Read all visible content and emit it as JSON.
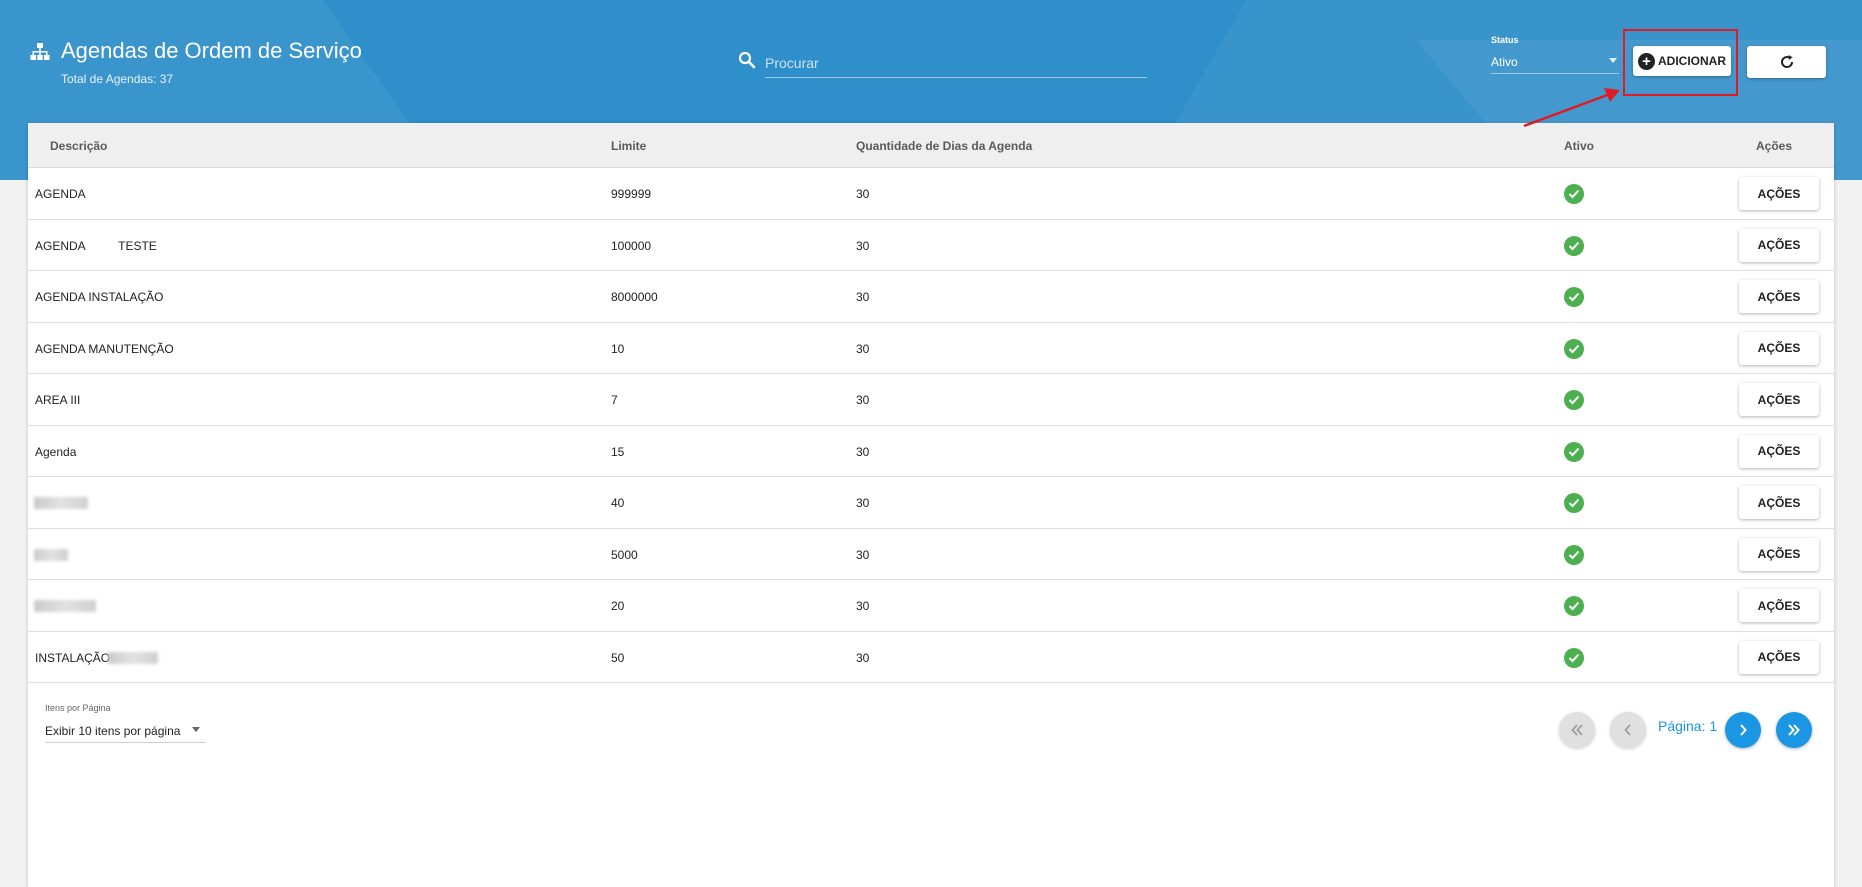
{
  "header": {
    "title": "Agendas de Ordem de Serviço",
    "subtitle": "Total de Agendas: 37",
    "title_icon": "sitemap-icon",
    "search": {
      "placeholder": "Procurar",
      "value": "",
      "icon": "search-icon"
    },
    "status": {
      "label": "Status",
      "value": "Ativo"
    },
    "add_label": "ADICIONAR",
    "refresh_icon": "refresh-icon"
  },
  "table": {
    "columns": [
      "Descrição",
      "Limite",
      "Quantidade de Dias da Agenda",
      "Ativo",
      "Ações"
    ],
    "rows": [
      {
        "descricao": "AGENDA",
        "limite": "999999",
        "dias": "30",
        "ativo": true,
        "acoes": "AÇÕES"
      },
      {
        "descricao": "AGENDA          TESTE",
        "limite": "100000",
        "dias": "30",
        "ativo": true,
        "acoes": "AÇÕES"
      },
      {
        "descricao": "AGENDA INSTALAÇÃO",
        "limite": "8000000",
        "dias": "30",
        "ativo": true,
        "acoes": "AÇÕES"
      },
      {
        "descricao": "AGENDA MANUTENÇÃO",
        "limite": "10",
        "dias": "30",
        "ativo": true,
        "acoes": "AÇÕES"
      },
      {
        "descricao": "AREA III",
        "limite": "7",
        "dias": "30",
        "ativo": true,
        "acoes": "AÇÕES"
      },
      {
        "descricao": "Agenda",
        "limite": "15",
        "dias": "30",
        "ativo": true,
        "acoes": "AÇÕES"
      },
      {
        "descricao": "",
        "limite": "40",
        "dias": "30",
        "ativo": true,
        "acoes": "AÇÕES"
      },
      {
        "descricao": "",
        "limite": "5000",
        "dias": "30",
        "ativo": true,
        "acoes": "AÇÕES"
      },
      {
        "descricao": "",
        "limite": "20",
        "dias": "30",
        "ativo": true,
        "acoes": "AÇÕES"
      },
      {
        "descricao": "INSTALAÇÃO",
        "limite": "50",
        "dias": "30",
        "ativo": true,
        "acoes": "AÇÕES"
      }
    ]
  },
  "footer": {
    "per_page_label": "Itens por Página",
    "per_page_value": "Exibir 10 itens por página",
    "page_label": "Página: 1"
  },
  "colors": {
    "header_bg": "#2f8fca",
    "accent": "#1a96e3",
    "active_check": "#4caf50",
    "highlight": "#e01b24"
  }
}
